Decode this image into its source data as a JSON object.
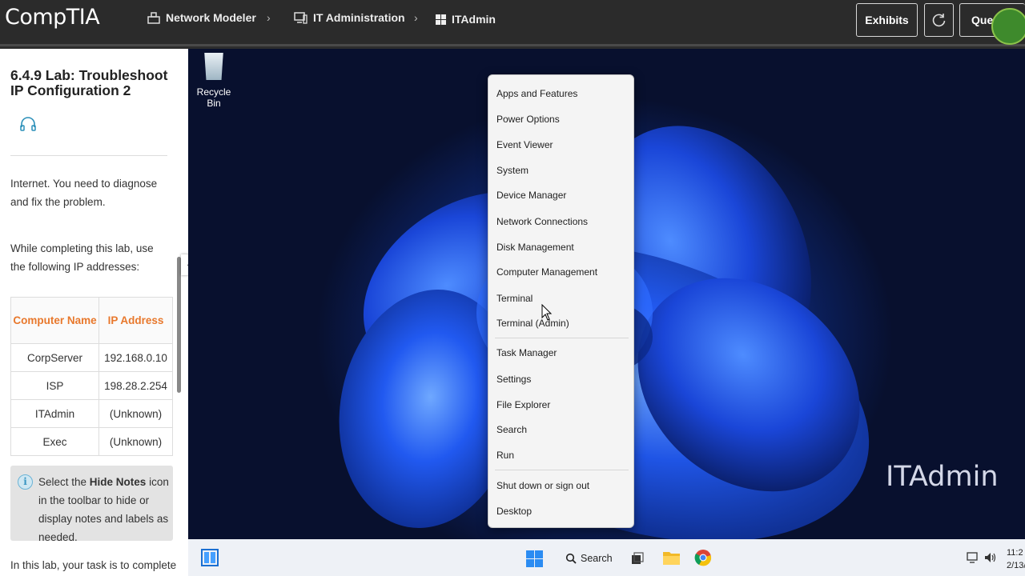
{
  "header": {
    "logo": "CompTIA",
    "breadcrumbs": [
      {
        "label": "Network Modeler",
        "icon": "network-modeler-icon"
      },
      {
        "label": "IT Administration",
        "icon": "computer-icon"
      },
      {
        "label": "ITAdmin",
        "icon": "windows-icon"
      }
    ],
    "separator": "›",
    "exhibits_label": "Exhibits",
    "questions_label": "Que",
    "accent": "#e8782c"
  },
  "left_panel": {
    "lab_title": "6.4.9 Lab: Troubleshoot IP Configuration 2",
    "intro_text": "Internet. You need to diagnose and fix the problem.",
    "ip_intro": "While completing this lab, use the following IP addresses:",
    "table": {
      "headers": [
        "Computer Name",
        "IP Address"
      ],
      "rows": [
        [
          "CorpServer",
          "192.168.0.10"
        ],
        [
          "ISP",
          "198.28.2.254"
        ],
        [
          "ITAdmin",
          "(Unknown)"
        ],
        [
          "Exec",
          "(Unknown)"
        ]
      ]
    },
    "note": {
      "pre": "Select the ",
      "bold": "Hide Notes",
      "post": " icon in the toolbar to hide or display notes and labels as needed."
    },
    "cut_text": "In this lab, your task is to complete"
  },
  "desktop": {
    "recycle_bin_label": "Recycle Bin",
    "computer_label": "ITAdmin"
  },
  "context_menu": {
    "items": [
      "Apps and Features",
      "Power Options",
      "Event Viewer",
      "System",
      "Device Manager",
      "Network Connections",
      "Disk Management",
      "Computer Management",
      "Terminal",
      "Terminal (Admin)",
      "Task Manager",
      "Settings",
      "File Explorer",
      "Search",
      "Run",
      "Shut down or sign out",
      "Desktop"
    ]
  },
  "taskbar": {
    "search_label": "Search",
    "time": "11:2",
    "date": "2/13/"
  }
}
